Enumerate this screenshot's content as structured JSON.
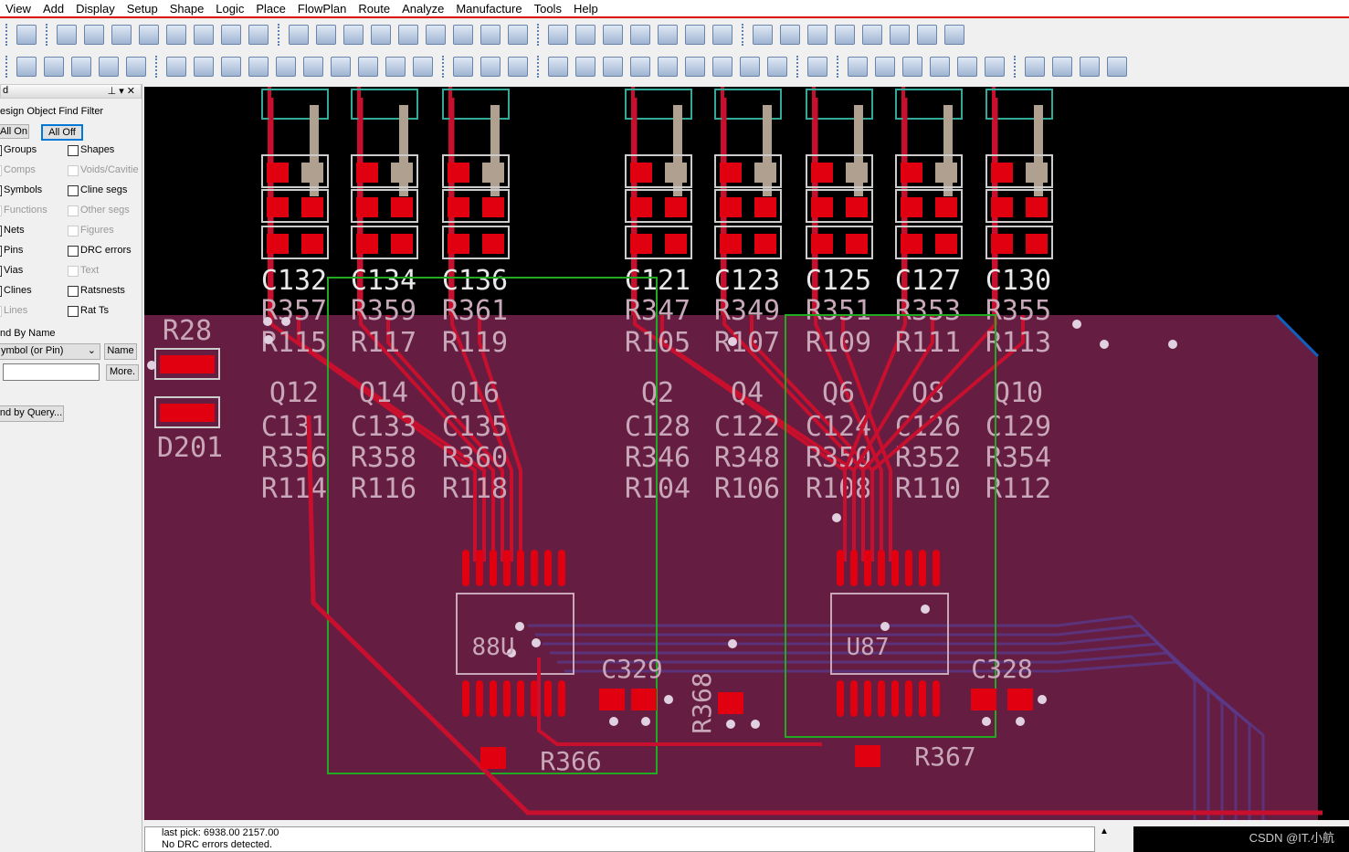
{
  "menu": [
    "View",
    "Add",
    "Display",
    "Setup",
    "Shape",
    "Logic",
    "Place",
    "FlowPlan",
    "Route",
    "Analyze",
    "Manufacture",
    "Tools",
    "Help"
  ],
  "panel": {
    "title": "d",
    "filter_title": "esign Object Find Filter",
    "all_on": "All On",
    "all_off": "All Off",
    "left_items": [
      {
        "label": "Groups",
        "enabled": true
      },
      {
        "label": "Comps",
        "enabled": false
      },
      {
        "label": "Symbols",
        "enabled": true
      },
      {
        "label": "Functions",
        "enabled": false
      },
      {
        "label": "Nets",
        "enabled": true
      },
      {
        "label": "Pins",
        "enabled": true
      },
      {
        "label": "Vias",
        "enabled": true
      },
      {
        "label": "Clines",
        "enabled": true
      },
      {
        "label": "Lines",
        "enabled": false
      }
    ],
    "right_items": [
      {
        "label": "Shapes",
        "enabled": true
      },
      {
        "label": "Voids/Cavitie",
        "enabled": false
      },
      {
        "label": "Cline segs",
        "enabled": true
      },
      {
        "label": "Other segs",
        "enabled": false
      },
      {
        "label": "Figures",
        "enabled": false
      },
      {
        "label": "DRC errors",
        "enabled": true
      },
      {
        "label": "Text",
        "enabled": false
      },
      {
        "label": "Ratsnests",
        "enabled": true
      },
      {
        "label": "Rat Ts",
        "enabled": true
      }
    ],
    "find_by_name": "nd By Name",
    "type_select": "ymbol (or Pin)",
    "name_button": "Name",
    "name_input": "",
    "more_button": "More.",
    "query_button": "nd by Query..."
  },
  "pcb": {
    "colors": {
      "board": "#661d42",
      "trace": "#c8102e",
      "pad": "#e00010",
      "silk": "#c8a8b8",
      "outline": "#22aa22",
      "via": "#e0d0e0",
      "inner": "#5a3a8a"
    },
    "columns": [
      [
        "C132",
        "R357",
        "R115",
        "Q12",
        "C131",
        "R356",
        "R114"
      ],
      [
        "C134",
        "R359",
        "R117",
        "Q14",
        "C133",
        "R358",
        "R116"
      ],
      [
        "C136",
        "R361",
        "R119",
        "Q16",
        "C135",
        "R360",
        "R118"
      ],
      [
        "C121",
        "R347",
        "R105",
        "Q2",
        "C128",
        "R346",
        "R104"
      ],
      [
        "C123",
        "R349",
        "R107",
        "Q4",
        "C122",
        "R348",
        "R106"
      ],
      [
        "C125",
        "R351",
        "R109",
        "Q6",
        "C124",
        "R350",
        "R108"
      ],
      [
        "C127",
        "R353",
        "R111",
        "Q8",
        "C126",
        "R352",
        "R110"
      ],
      [
        "C130",
        "R355",
        "R113",
        "Q10",
        "C129",
        "R354",
        "R112"
      ]
    ],
    "other_labels": [
      "R28",
      "D201",
      "88U",
      "U87",
      "C329",
      "C328",
      "R366",
      "R367",
      "R368"
    ]
  },
  "status": {
    "line1": "last pick:  6938.00 2157.00",
    "line2": "No DRC errors detected."
  },
  "watermark": "CSDN @IT.小航"
}
